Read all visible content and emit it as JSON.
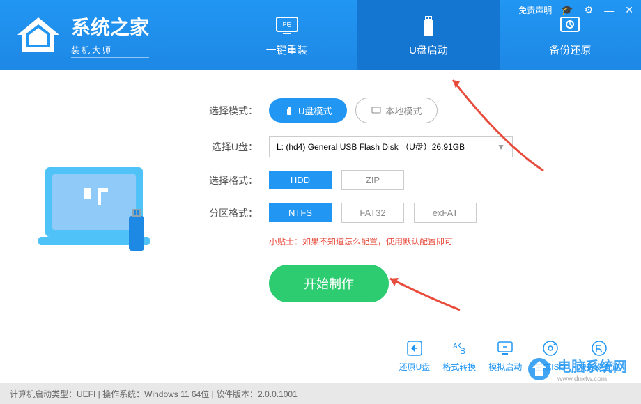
{
  "window": {
    "disclaimer": "免责声明",
    "min": "—",
    "close": "✕"
  },
  "logo": {
    "title": "系统之家",
    "subtitle": "装机大师"
  },
  "tabs": {
    "reinstall": "一键重装",
    "usb": "U盘启动",
    "backup": "备份还原"
  },
  "form": {
    "mode_label": "选择模式：",
    "mode_usb": "U盘模式",
    "mode_local": "本地模式",
    "usb_label": "选择U盘：",
    "usb_value": "L: (hd4) General USB Flash Disk （U盘）26.91GB",
    "format_label": "选择格式：",
    "format_hdd": "HDD",
    "format_zip": "ZIP",
    "partition_label": "分区格式：",
    "part_ntfs": "NTFS",
    "part_fat32": "FAT32",
    "part_exfat": "exFAT",
    "tip": "小贴士：如果不知道怎么配置，使用默认配置即可",
    "start": "开始制作"
  },
  "tools": {
    "restore": "还原U盘",
    "convert": "格式转换",
    "simulate": "模拟启动",
    "iso": "生成ISO",
    "hotkey": "快捷键查询"
  },
  "footer": {
    "text": "计算机启动类型：UEFI | 操作系统：Windows 11 64位 | 软件版本：2.0.0.1001"
  },
  "watermark": {
    "title": "电脑系统网",
    "url": "www.dnxtw.com"
  }
}
